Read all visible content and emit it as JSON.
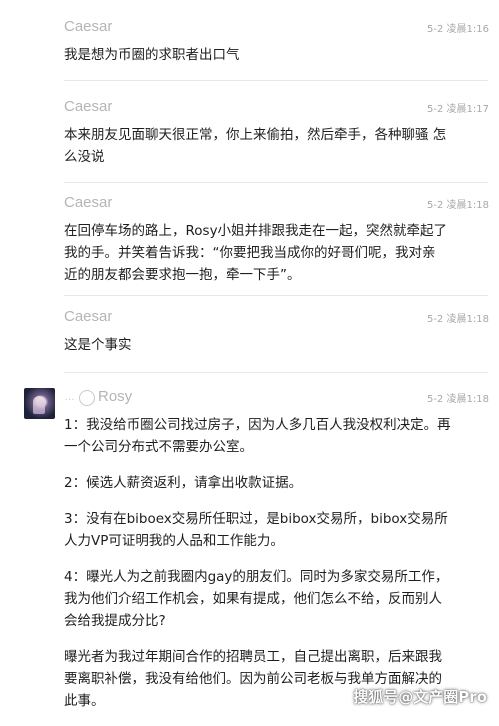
{
  "messages": [
    {
      "author": "Caesar",
      "time": "5-2 凌晨1:16",
      "lines": [
        "我是想为币圈的求职者出口气"
      ]
    },
    {
      "author": "Caesar",
      "time": "5-2 凌晨1:17",
      "lines": [
        "本来朋友见面聊天很正常，你上来偷拍，然后牵手，各种聊骚 怎",
        "么没说"
      ]
    },
    {
      "author": "Caesar",
      "time": "5-2 凌晨1:18",
      "lines": [
        "在回停车场的路上，Rosy小姐并排跟我走在一起，突然就牵起了",
        "我的手。并笑着告诉我：“你要把我当成你的好哥们呢，我对亲",
        "近的朋友都会要求抱一抱，牵一下手”。"
      ]
    },
    {
      "author": "Caesar",
      "time": "5-2 凌晨1:18",
      "lines": [
        "这是个事实"
      ]
    },
    {
      "author": "Rosy",
      "time": "5-2 凌晨1:18",
      "paragraphs": [
        [
          "1：我没给币圈公司找过房子，因为人多几百人我没权利决定。再",
          "一个公司分布式不需要办公室。"
        ],
        [
          "2：候选人薪资返利，请拿出收款证据。"
        ],
        [
          "3：没有在biboex交易所任职过，是bibox交易所，bibox交易所",
          "人力VP可证明我的人品和工作能力。"
        ],
        [
          "4：曝光人为之前我圈内gay的朋友们。同时为多家交易所工作，",
          "我为他们介绍工作机会，如果有提成，他们怎么不给，反而别人",
          "会给我提成分比?"
        ],
        [
          "曝光者为我过年期间合作的招聘员工，自己提出离职，后来跟我",
          "要离职补偿，我没有给他们。因为前公司老板与我单方面解决的",
          "此事。"
        ]
      ]
    }
  ],
  "watermark": "搜狐号@文产圈Pro",
  "colors": {
    "author": "#b5b5b5",
    "time": "#a8a8a8",
    "text": "#1e1e1e",
    "separator": "#e8e8e8"
  }
}
